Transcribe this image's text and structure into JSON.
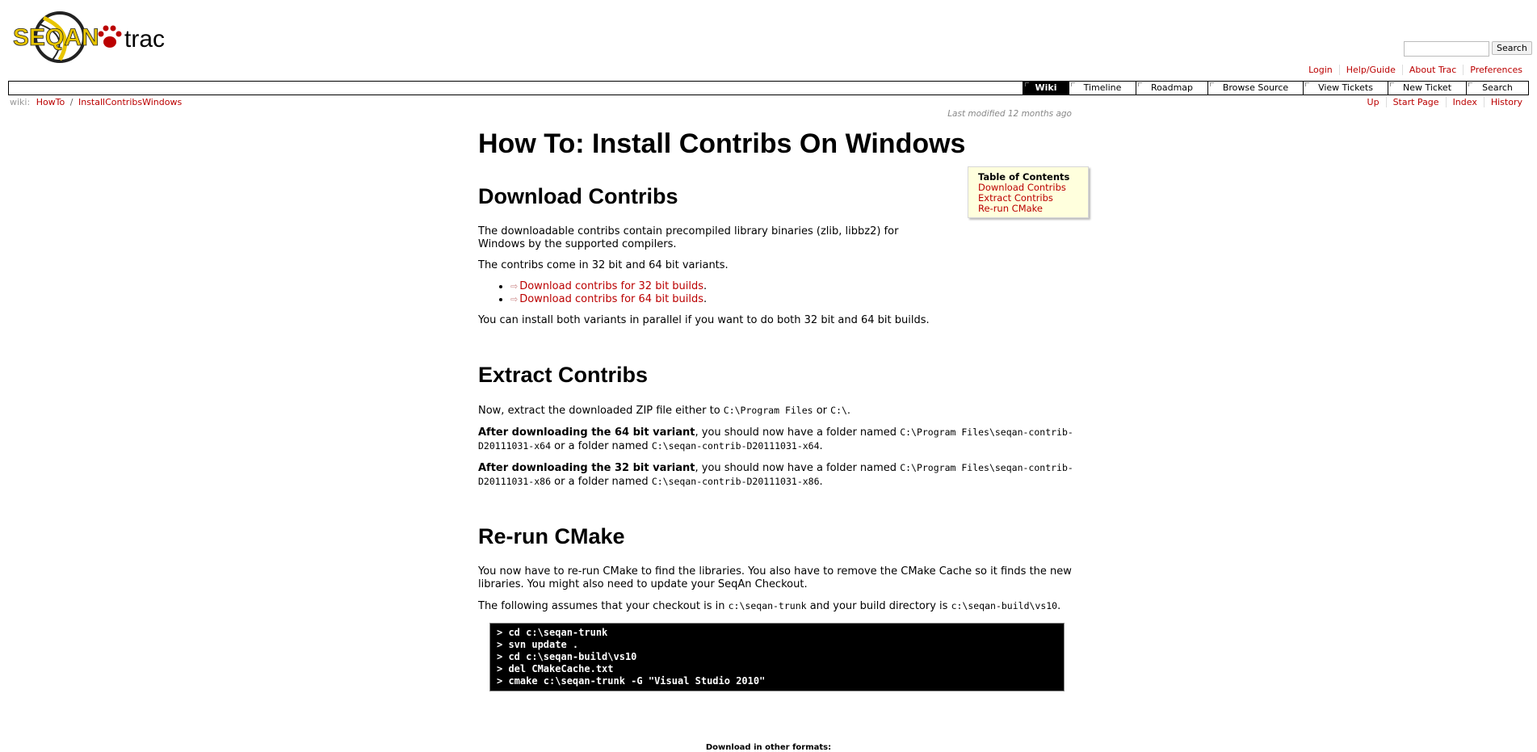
{
  "header": {
    "logo_text_seqan": "SEQAN",
    "logo_text_trac": "trac"
  },
  "search": {
    "placeholder": "",
    "button_label": "Search"
  },
  "metanav": [
    {
      "label": "Login"
    },
    {
      "label": "Help/Guide"
    },
    {
      "label": "About Trac"
    },
    {
      "label": "Preferences"
    }
  ],
  "mainnav": [
    {
      "label": "Wiki",
      "active": true
    },
    {
      "label": "Timeline"
    },
    {
      "label": "Roadmap"
    },
    {
      "label": "Browse Source"
    },
    {
      "label": "View Tickets"
    },
    {
      "label": "New Ticket"
    },
    {
      "label": "Search"
    }
  ],
  "breadcrumb": {
    "prefix": "wiki:",
    "parent": "HowTo",
    "separator": "/",
    "current": "InstallContribsWindows"
  },
  "ctxtnav": [
    {
      "label": "Up"
    },
    {
      "label": "Start Page"
    },
    {
      "label": "Index"
    },
    {
      "label": "History"
    }
  ],
  "page": {
    "last_modified": "Last modified 12 months ago",
    "title": "How To: Install Contribs On Windows",
    "toc": {
      "title": "Table of Contents",
      "items": [
        "Download Contribs",
        "Extract Contribs",
        "Re-run CMake"
      ]
    },
    "s1": {
      "heading": "Download Contribs",
      "p1": "The downloadable contribs contain precompiled library binaries (zlib, libbz2) for Windows by the supported compilers.",
      "p2": "The contribs come in 32 bit and 64 bit variants.",
      "link32": "Download contribs for 32 bit builds",
      "link64": "Download contribs for 64 bit builds",
      "p3": "You can install both variants in parallel if you want to do both 32 bit and 64 bit builds."
    },
    "s2": {
      "heading": "Extract Contribs",
      "p1_a": "Now, extract the downloaded ZIP file either to ",
      "p1_c1": "C:\\Program Files",
      "p1_b": " or ",
      "p1_c2": "C:\\",
      "p1_end": ".",
      "p2_bold": "After downloading the 64 bit variant",
      "p2_a": ", you should now have a folder named ",
      "p2_c1": "C:\\Program Files\\seqan-contrib-D20111031-x64",
      "p2_b": " or a folder named ",
      "p2_c2": "C:\\seqan-contrib-D20111031-x64",
      "p2_end": ".",
      "p3_bold": "After downloading the 32 bit variant",
      "p3_a": ", you should now have a folder named ",
      "p3_c1": "C:\\Program Files\\seqan-contrib-D20111031-x86",
      "p3_b": " or a folder named ",
      "p3_c2": "C:\\seqan-contrib-D20111031-x86",
      "p3_end": "."
    },
    "s3": {
      "heading": "Re-run CMake",
      "p1": "You now have to re-run CMake to find the libraries. You also have to remove the CMake Cache so it finds the new libraries. You might also need to update your SeqAn Checkout.",
      "p2_a": "The following assumes that your checkout is in ",
      "p2_c1": "c:\\seqan-trunk",
      "p2_b": " and your build directory is ",
      "p2_c2": "c:\\seqan-build\\vs10",
      "p2_end": ".",
      "code": [
        "> cd c:\\seqan-trunk",
        "> svn update .",
        "> cd c:\\seqan-build\\vs10",
        "> del CMakeCache.txt",
        "> cmake c:\\seqan-trunk -G \"Visual Studio 2010\""
      ]
    }
  },
  "footer": {
    "altlinks": "Download in other formats:"
  },
  "colors": {
    "link": "#bb0000",
    "toc_bg": "#ffffdd"
  }
}
